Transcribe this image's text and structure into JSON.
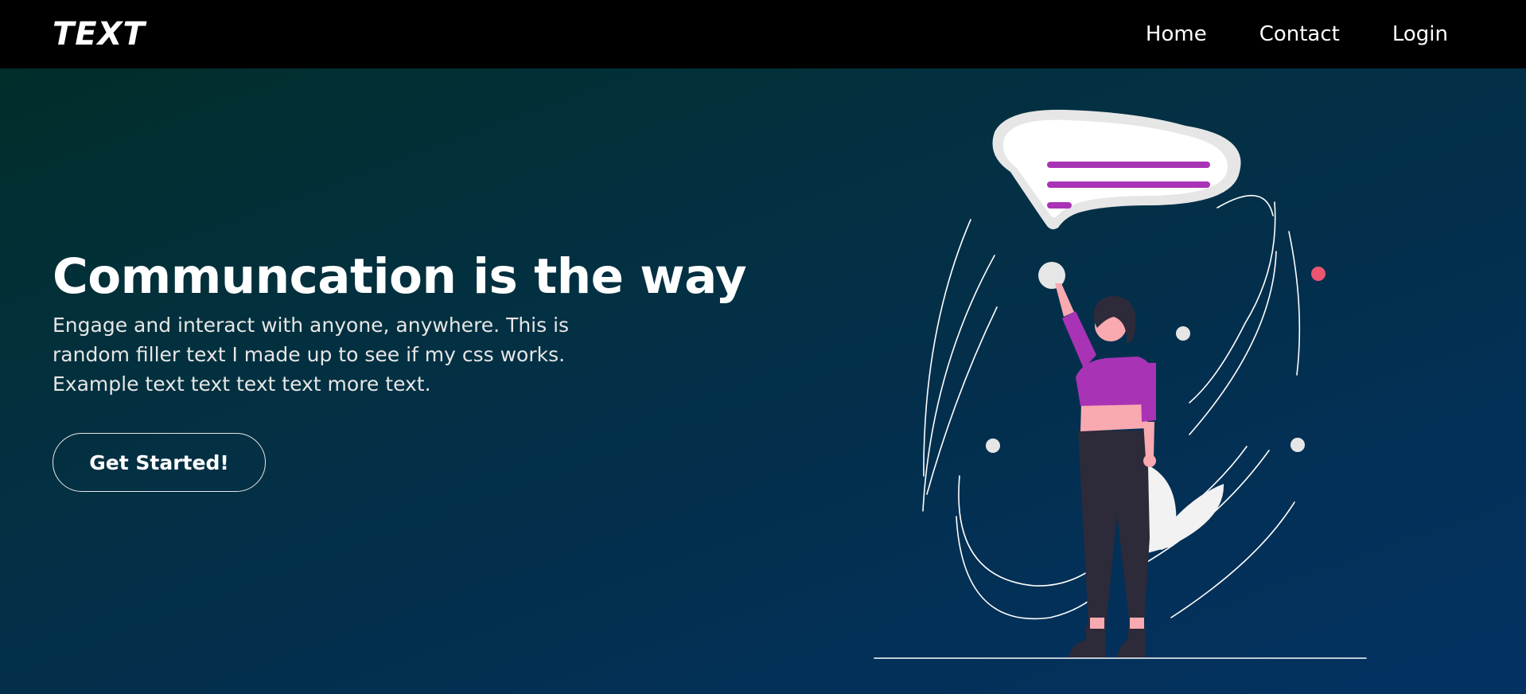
{
  "navbar": {
    "logo": "TEXT",
    "links": [
      {
        "label": "Home"
      },
      {
        "label": "Contact"
      },
      {
        "label": "Login"
      }
    ]
  },
  "hero": {
    "title": "Communcation is the way",
    "text": "Engage and interact with anyone, anywhere. This is random filler text I made up to see if my css works. Example text text text text more text.",
    "cta_label": "Get Started!"
  },
  "colors": {
    "navbar_bg": "#000000",
    "hero_gradient_start": "#012e2a",
    "hero_gradient_end": "#033263",
    "accent_purple": "#a933b5",
    "accent_pink": "#ec5570",
    "skin": "#f9a9b0",
    "dark_clothes": "#2d2a3a"
  },
  "illustration": {
    "icon": "person-with-speech-bubble-illustration"
  }
}
